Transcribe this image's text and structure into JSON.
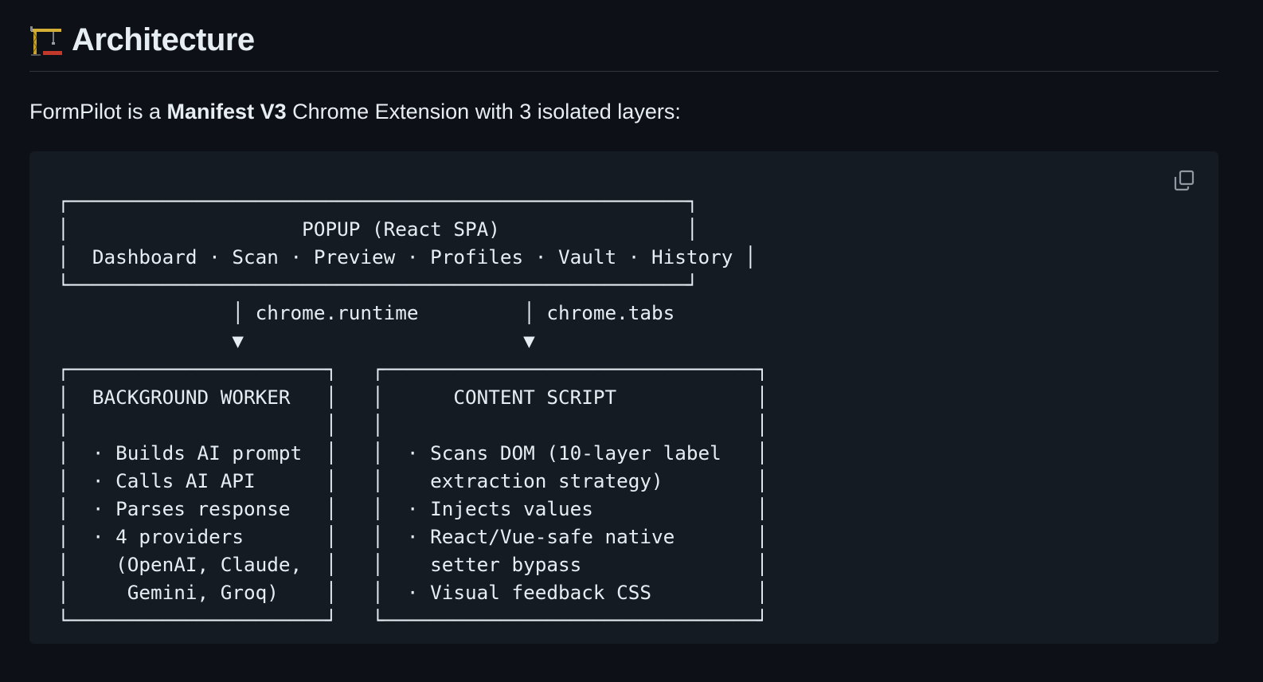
{
  "section": {
    "icon": "building-construction-icon",
    "title": "Architecture"
  },
  "intro": {
    "prefix": "FormPilot is a ",
    "bold": "Manifest V3",
    "suffix": " Chrome Extension with 3 isolated layers:"
  },
  "code_block": {
    "copy_icon": "copy-icon",
    "lines": [
      "┌─────────────────────────────────────────────────────┐",
      "│                    POPUP (React SPA)                │",
      "│  Dashboard · Scan · Preview · Profiles · Vault · History │",
      "└─────────────────────────────────────────────────────┘",
      "               │ chrome.runtime         │ chrome.tabs",
      "               ▼                        ▼",
      "┌──────────────────────┐   ┌────────────────────────────────┐",
      "│  BACKGROUND WORKER   │   │      CONTENT SCRIPT            │",
      "│                      │   │                                │",
      "│  · Builds AI prompt  │   │  · Scans DOM (10-layer label   │",
      "│  · Calls AI API      │   │    extraction strategy)        │",
      "│  · Parses response   │   │  · Injects values              │",
      "│  · 4 providers       │   │  · React/Vue-safe native       │",
      "│    (OpenAI, Claude,  │   │    setter bypass               │",
      "│     Gemini, Groq)    │   │  · Visual feedback CSS         │",
      "└──────────────────────┘   └────────────────────────────────┘"
    ]
  }
}
